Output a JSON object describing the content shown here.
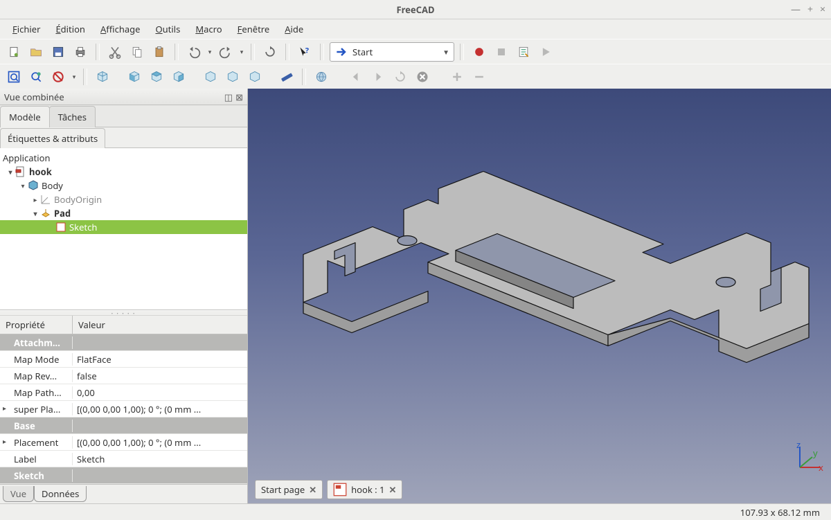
{
  "window": {
    "title": "FreeCAD"
  },
  "menu": {
    "file": "Fichier",
    "edit": "Édition",
    "view": "Affichage",
    "tools": "Outils",
    "macro": "Macro",
    "windows": "Fenêtre",
    "help": "Aide"
  },
  "workbench": {
    "selected": "Start"
  },
  "panel": {
    "title": "Vue combinée",
    "tab_model": "Modèle",
    "tab_tasks": "Tâches",
    "subtab_labels": "Étiquettes & attributs"
  },
  "tree": {
    "root": "Application",
    "doc": "hook",
    "body": "Body",
    "bodyorigin": "BodyOrigin",
    "pad": "Pad",
    "sketch": "Sketch"
  },
  "props": {
    "hdr_prop": "Propriété",
    "hdr_val": "Valeur",
    "sec_attach": "Attachm...",
    "mapmode_l": "Map Mode",
    "mapmode_v": "FlatFace",
    "maprev_l": "Map Rev...",
    "maprev_v": "false",
    "mappath_l": "Map Path...",
    "mappath_v": "0,00",
    "super_l": "super Pla...",
    "super_v": "[(0,00 0,00 1,00); 0 °; (0 mm ...",
    "sec_base": "Base",
    "place_l": "Placement",
    "place_v": "[(0,00 0,00 1,00); 0 °; (0 mm ...",
    "label_l": "Label",
    "label_v": "Sketch",
    "sec_sketch": "Sketch"
  },
  "bottomtabs": {
    "view": "Vue",
    "data": "Données"
  },
  "doctabs": {
    "start": "Start page",
    "hook": "hook : 1"
  },
  "status": {
    "dims": "107.93 x 68.12 mm"
  }
}
